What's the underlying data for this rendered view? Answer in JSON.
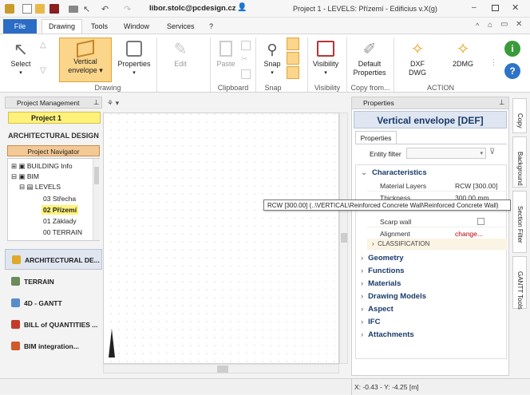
{
  "window": {
    "user": "libor.stolc@pcdesign.cz",
    "title": "Project 1 - LEVELS: Přízemí - Edificius v.X(g)"
  },
  "menu": {
    "file": "File",
    "tabs": [
      "Drawing",
      "Tools",
      "Window",
      "Services",
      "?"
    ]
  },
  "ribbon": {
    "select": "Select",
    "vertical_envelope": [
      "Vertical",
      "envelope"
    ],
    "properties": "Properties",
    "edit": "Edit",
    "paste": "Paste",
    "snap": "Snap",
    "visibility": "Visibility",
    "default_props": [
      "Default",
      "Properties"
    ],
    "dxf": [
      "DXF",
      "DWG"
    ],
    "dmg": "2DMG",
    "groups": {
      "drawing": "Drawing",
      "clipboard": "Clipboard",
      "snap": "Snap",
      "visibility": "Visibility",
      "copy_from": "Copy from...",
      "action": "ACTION"
    }
  },
  "left": {
    "header": "Project Management",
    "project": "Project 1",
    "section": "ARCHITECTURAL DESIGN",
    "navigator": "Project Navigator",
    "tree": [
      "BUILDING Info",
      "BIM",
      "LEVELS",
      "03 Střecha",
      "02 Přízemí",
      "01 Základy",
      "00 TERRAIN"
    ],
    "nav": [
      "ARCHITECTURAL DE...",
      "TERRAIN",
      "4D - GANTT",
      "BILL of QUANTITIES ...",
      "BIM integration..."
    ]
  },
  "right": {
    "header": "Properties",
    "title": "Vertical envelope [DEF]",
    "tab": "Properties",
    "filter_label": "Entity filter",
    "characteristics": "Characteristics",
    "rows": [
      {
        "k": "Material Layers",
        "v": "RCW [300.00]"
      },
      {
        "k": "Thickness",
        "v": "300.00 mm"
      },
      {
        "k": "Scarp wall",
        "v": ""
      },
      {
        "k": "Alignment",
        "v": "change..."
      }
    ],
    "classification": "CLASSIFICATION",
    "categories": [
      "Geometry",
      "Functions",
      "Materials",
      "Drawing Models",
      "Aspect",
      "IFC",
      "Attachments"
    ]
  },
  "tooltip": "RCW [300.00]   (..\\VERTICAL\\Reinforced Concrete Wall\\Reinforced Concrete Wall)",
  "sidetabs": [
    "Copy",
    "Background",
    "Section Filter",
    "GANTT Tools"
  ],
  "status": {
    "coords": "X: -0.43 - Y: -4.25 [m]"
  }
}
